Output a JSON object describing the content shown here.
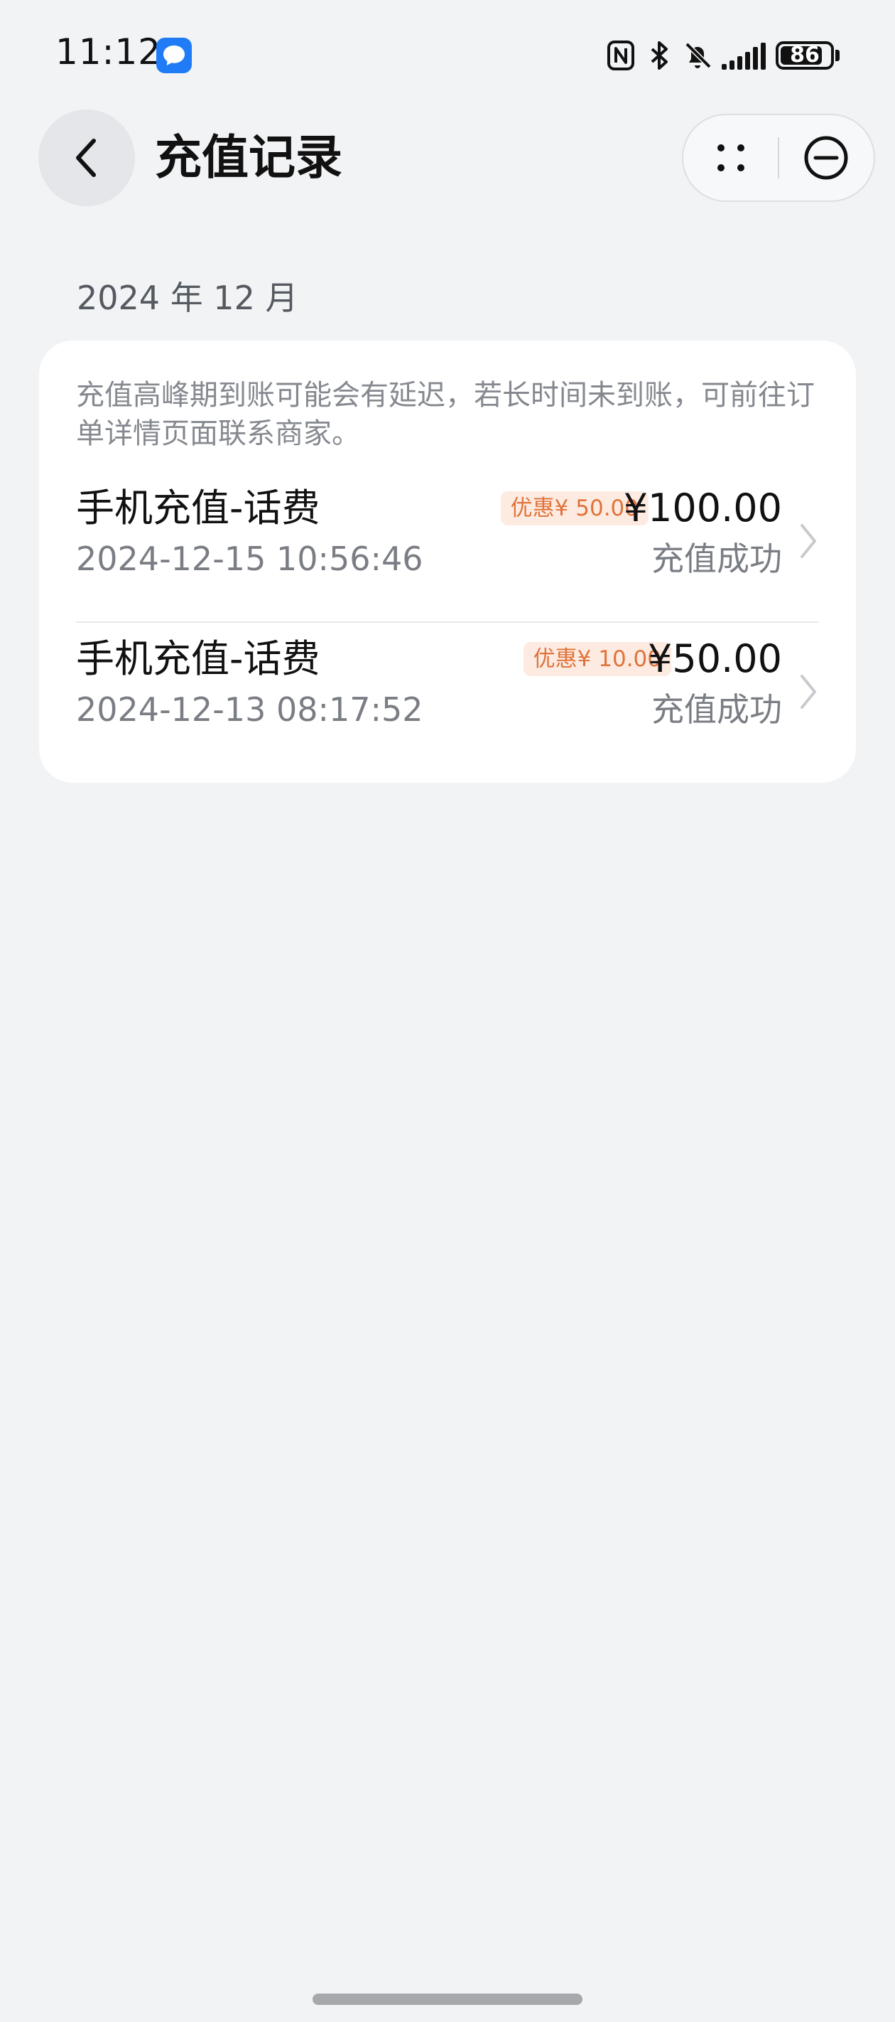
{
  "status_bar": {
    "time": "11:12",
    "battery": "86",
    "battery_level": 0.86,
    "icons": [
      "message-icon",
      "nfc-icon",
      "bluetooth-icon",
      "mute-bell-icon",
      "signal-icon",
      "battery-icon"
    ]
  },
  "header": {
    "title": "充值记录",
    "back_icon": "chevron-left-icon",
    "capsule_icons": [
      "more-dots-icon",
      "close-circle-icon"
    ]
  },
  "month": "2024 年 12 月",
  "notice": "充值高峰期到账可能会有延迟，若长时间未到账，可前往订单详情页面联系商家。",
  "records": [
    {
      "title": "手机充值-话费",
      "time": "2024-12-15 10:56:46",
      "discount": "优惠¥ 50.00",
      "amount": "¥100.00",
      "status": "充值成功"
    },
    {
      "title": "手机充值-话费",
      "time": "2024-12-13 08:17:52",
      "discount": "优惠¥ 10.00",
      "amount": "¥50.00",
      "status": "充值成功"
    }
  ],
  "colors": {
    "background": "#f1f3f5",
    "card": "#ffffff",
    "badge_bg": "#fdebe2",
    "badge_text": "#e0733a",
    "message_icon": "#1f7cf6"
  }
}
